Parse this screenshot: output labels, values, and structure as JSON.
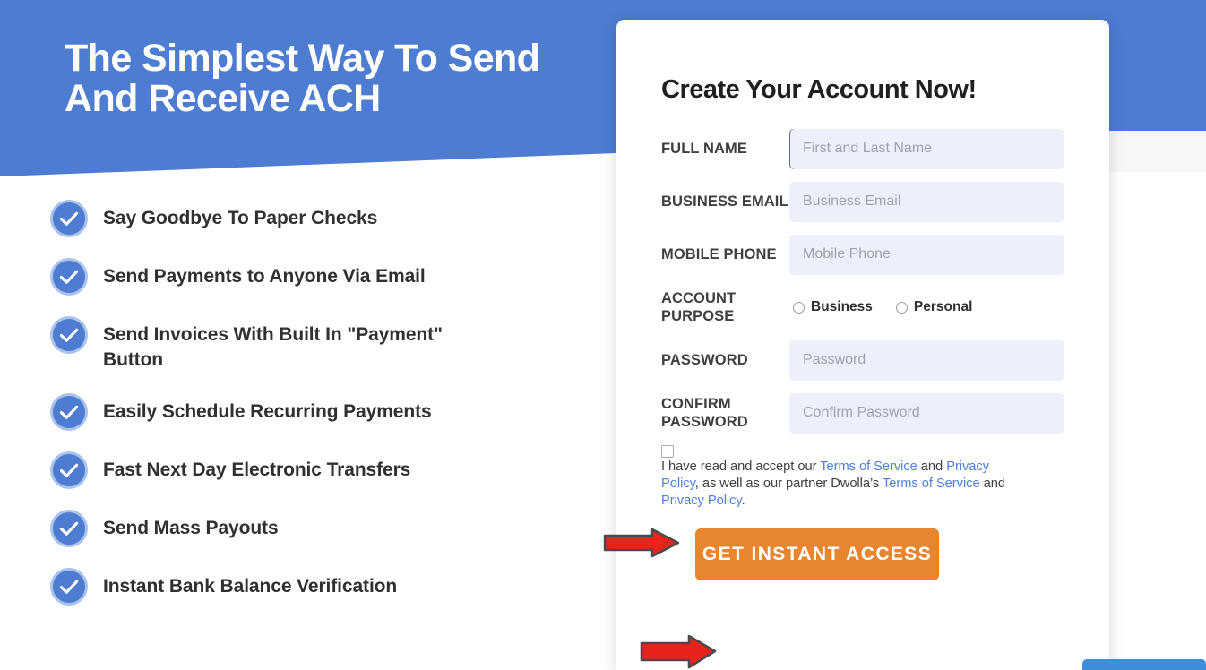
{
  "hero": {
    "title": "The Simplest Way To Send\nAnd Receive ACH",
    "background_color": "#4d7cd1"
  },
  "benefits": {
    "items": [
      {
        "label": "Say Goodbye To Paper Checks"
      },
      {
        "label": "Send Payments to Anyone Via Email"
      },
      {
        "label": "Send Invoices With Built In \"Payment\" Button"
      },
      {
        "label": "Easily Schedule Recurring Payments"
      },
      {
        "label": "Fast Next Day Electronic Transfers"
      },
      {
        "label": "Send Mass Payouts"
      },
      {
        "label": "Instant Bank Balance Verification"
      }
    ],
    "icon": "check-circle-icon",
    "icon_color": "#4d7cd1"
  },
  "form": {
    "title": "Create Your Account Now!",
    "fields": [
      {
        "label": "FULL NAME",
        "placeholder": "First and Last Name",
        "value": ""
      },
      {
        "label": "BUSINESS EMAIL",
        "placeholder": "Business Email",
        "value": ""
      },
      {
        "label": "MOBILE PHONE",
        "placeholder": "Mobile Phone",
        "value": ""
      }
    ],
    "account_purpose": {
      "label": "ACCOUNT PURPOSE",
      "options": [
        {
          "label": "Business",
          "selected": false
        },
        {
          "label": "Personal",
          "selected": false
        }
      ]
    },
    "password_fields": [
      {
        "label": "PASSWORD",
        "placeholder": "Password",
        "value": ""
      },
      {
        "label": "CONFIRM PASSWORD",
        "placeholder": "Confirm Password",
        "value": ""
      }
    ],
    "terms": {
      "checked": false,
      "segments": [
        {
          "text": "I have read and accept our ",
          "link": false
        },
        {
          "text": "Terms of Service",
          "link": true
        },
        {
          "text": " and ",
          "link": false
        },
        {
          "text": "Privacy Policy",
          "link": true
        },
        {
          "text": ", as well as our partner Dwolla’s ",
          "link": false
        },
        {
          "text": "Terms of Service",
          "link": true
        },
        {
          "text": " and ",
          "link": false
        },
        {
          "text": "Privacy Policy",
          "link": true
        },
        {
          "text": ".",
          "link": false
        }
      ],
      "link_color": "#4f7fe0"
    },
    "cta": {
      "label": "GET INSTANT ACCESS",
      "color": "#e8862f"
    }
  },
  "annotations": {
    "arrow_color": "#e8231b",
    "arrows": [
      {
        "name": "arrow-pointing-to-terms-checkbox",
        "target": "terms-checkbox"
      },
      {
        "name": "arrow-pointing-to-cta-button",
        "target": "get-instant-access-button"
      }
    ]
  }
}
